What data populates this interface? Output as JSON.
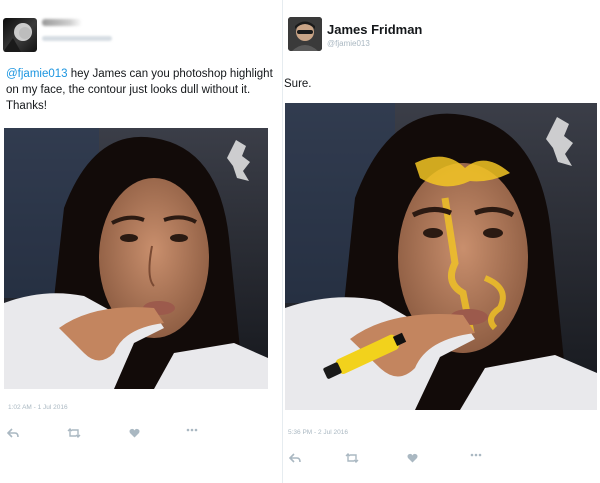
{
  "left_tweet": {
    "message_mention": "@fjamie013",
    "message_rest": " hey James can you photoshop highlight on my face, the contour just looks dull without it. Thanks!",
    "timestamp": "1:02 AM - 1 Jul 2016"
  },
  "right_tweet": {
    "name": "James Fridman",
    "handle": "@fjamie013",
    "message": "Sure.",
    "timestamp": "5:36 PM - 2 Jul 2016"
  },
  "actions": [
    "reply-icon",
    "retweet-icon",
    "like-icon",
    "more-icon"
  ],
  "colors": {
    "mention": "#1b95e0",
    "highlight": "#f3c623",
    "muted": "#aab8c2"
  }
}
